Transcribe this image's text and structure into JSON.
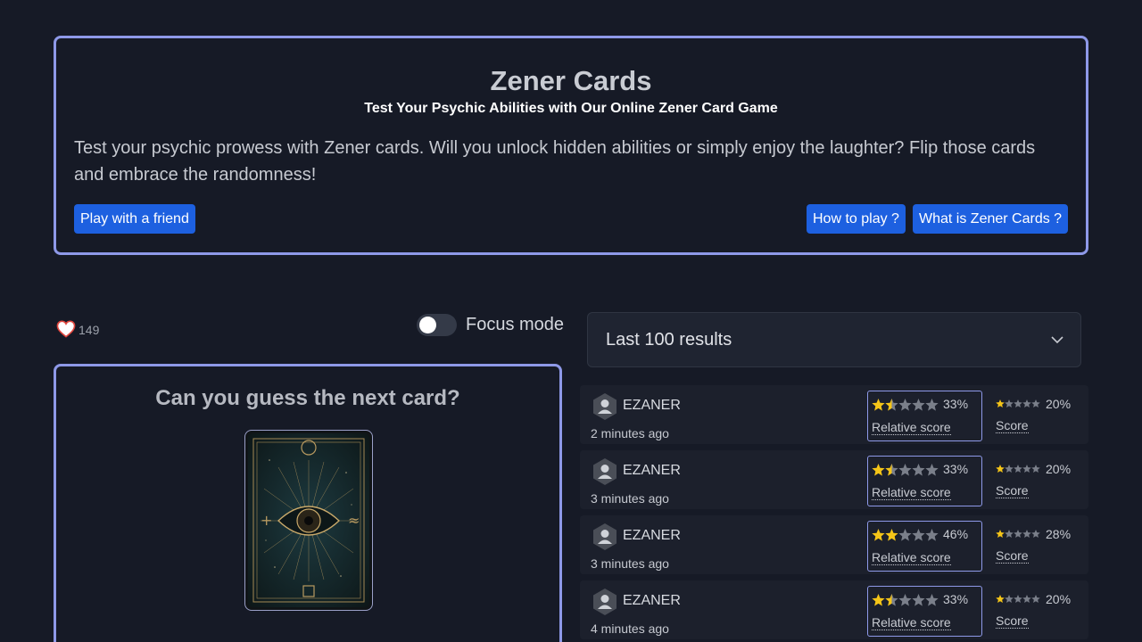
{
  "hero": {
    "title": "Zener Cards",
    "subtitle": "Test Your Psychic Abilities with Our Online Zener Card Game",
    "description": "Test your psychic prowess with Zener cards. Will you unlock hidden abilities or simply enjoy the laughter? Flip those cards and embrace the randomness!",
    "buttons": {
      "play_friend": "Play with a friend",
      "how_to_play": "How to play ?",
      "what_is": "What is Zener Cards ?"
    }
  },
  "likes": {
    "icon": "heart-icon",
    "count": "149"
  },
  "focus_mode": {
    "label": "Focus mode",
    "enabled": false
  },
  "game": {
    "prompt": "Can you guess the next card?",
    "card_icon": "eye-card-back"
  },
  "results_dropdown": {
    "label": "Last 100 results",
    "icon": "chevron-down-icon"
  },
  "results": [
    {
      "name": "EZANER",
      "time": "2 minutes ago",
      "relative_stars": 1.5,
      "relative_pct": "33%",
      "relative_label": "Relative score",
      "score_stars": 1,
      "score_pct": "20%",
      "score_label": "Score"
    },
    {
      "name": "EZANER",
      "time": "3 minutes ago",
      "relative_stars": 1.5,
      "relative_pct": "33%",
      "relative_label": "Relative score",
      "score_stars": 1,
      "score_pct": "20%",
      "score_label": "Score"
    },
    {
      "name": "EZANER",
      "time": "3 minutes ago",
      "relative_stars": 2,
      "relative_pct": "46%",
      "relative_label": "Relative score",
      "score_stars": 1,
      "score_pct": "28%",
      "score_label": "Score"
    },
    {
      "name": "EZANER",
      "time": "4 minutes ago",
      "relative_stars": 1.5,
      "relative_pct": "33%",
      "relative_label": "Relative score",
      "score_stars": 1,
      "score_pct": "20%",
      "score_label": "Score"
    }
  ],
  "colors": {
    "accent_border": "#8e99e8",
    "button": "#1d60e0",
    "star_filled": "#f5c518",
    "star_empty": "#7a7f8a",
    "background": "#161a26"
  }
}
